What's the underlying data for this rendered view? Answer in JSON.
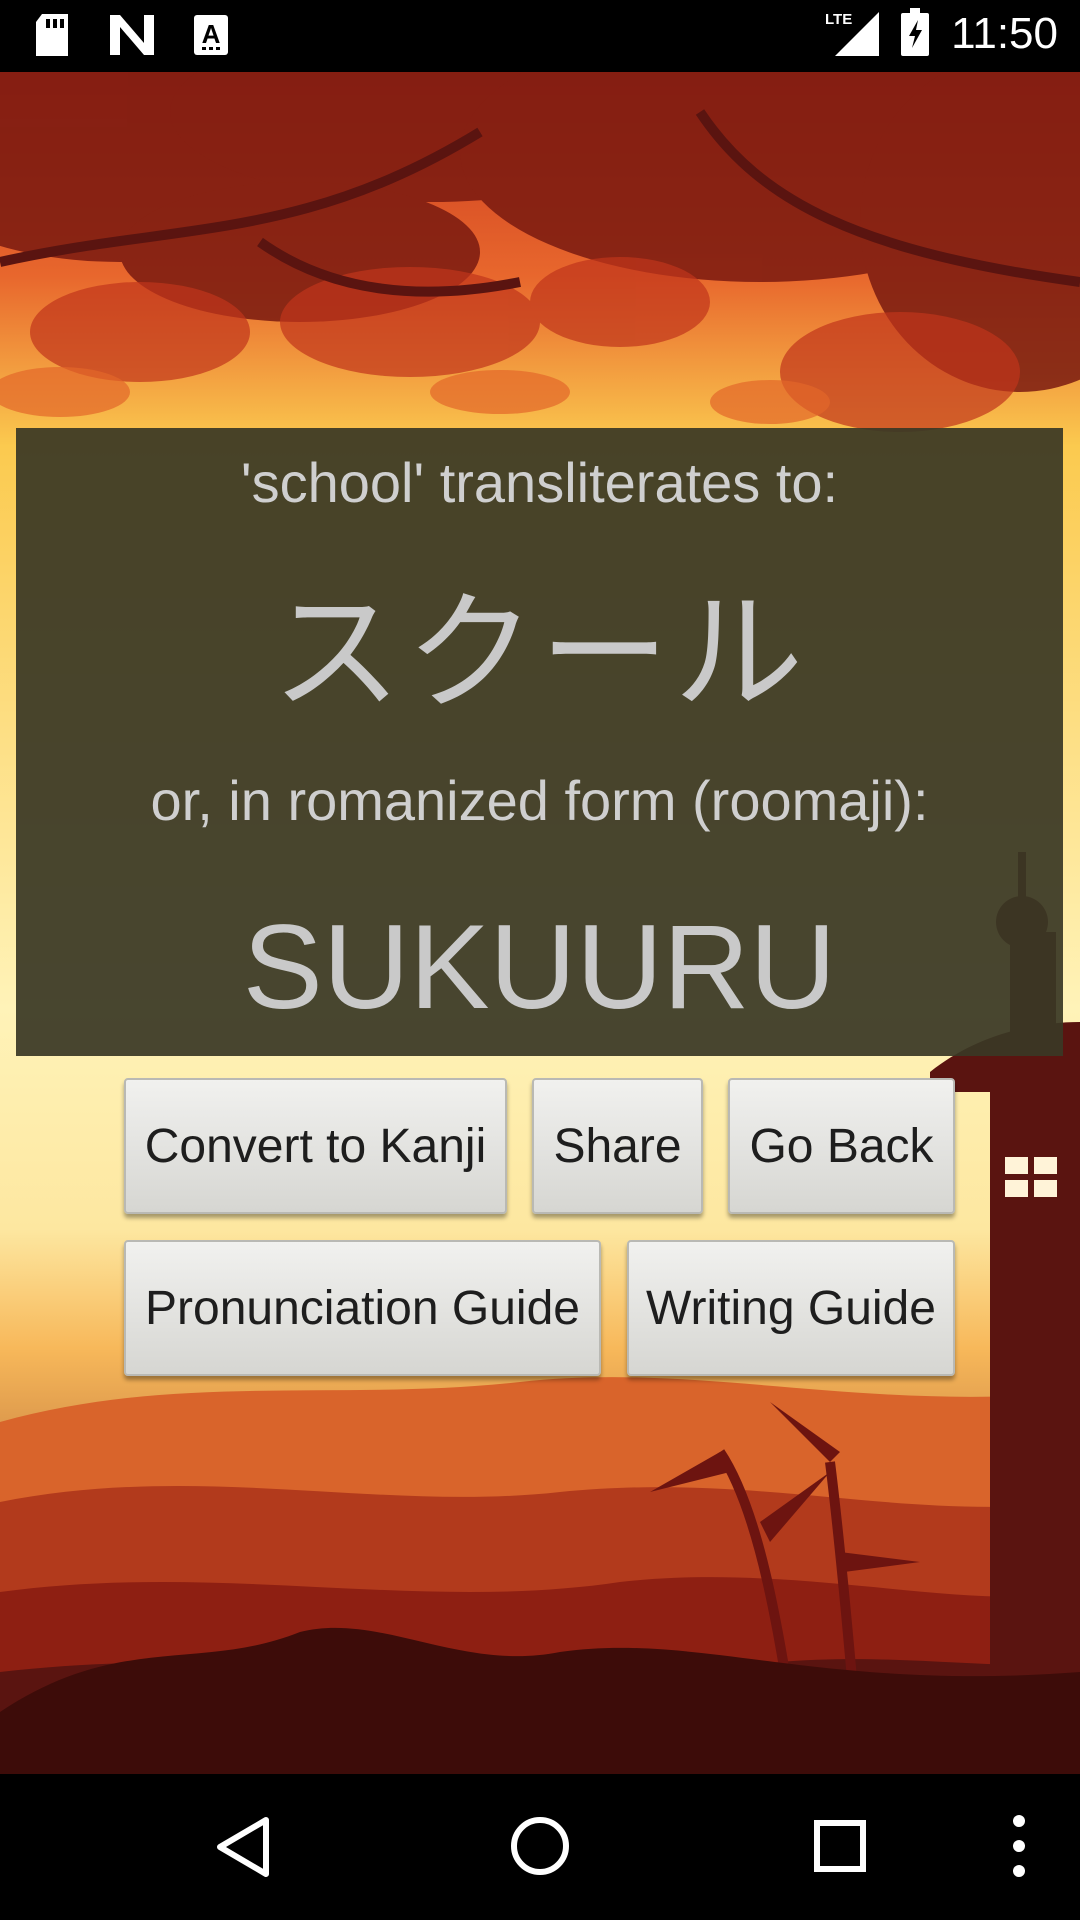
{
  "status_bar": {
    "time": "11:50",
    "icons": [
      "sd-card-icon",
      "n-logo-icon",
      "a-font-icon",
      "lte-signal-icon",
      "battery-icon"
    ],
    "network_label": "LTE"
  },
  "panel": {
    "prompt": "'school' transliterates to:",
    "katakana": "スクール",
    "romanized_prompt": "or, in romanized form (roomaji):",
    "romaji": "SUKUURU"
  },
  "buttons": {
    "convert_kanji": "Convert to Kanji",
    "share": "Share",
    "go_back": "Go Back",
    "pronunciation_guide": "Pronunciation Guide",
    "writing_guide": "Writing Guide"
  },
  "nav": {
    "icons": [
      "back-icon",
      "home-icon",
      "recents-icon",
      "overflow-menu-icon"
    ]
  },
  "colors": {
    "panel_bg": "#3a3825",
    "sky_top": "#e2552a",
    "sky_mid": "#fbd35a",
    "sky_light": "#fdf0b3",
    "hills": "#8e1f12",
    "silhouette": "#5a1410"
  }
}
